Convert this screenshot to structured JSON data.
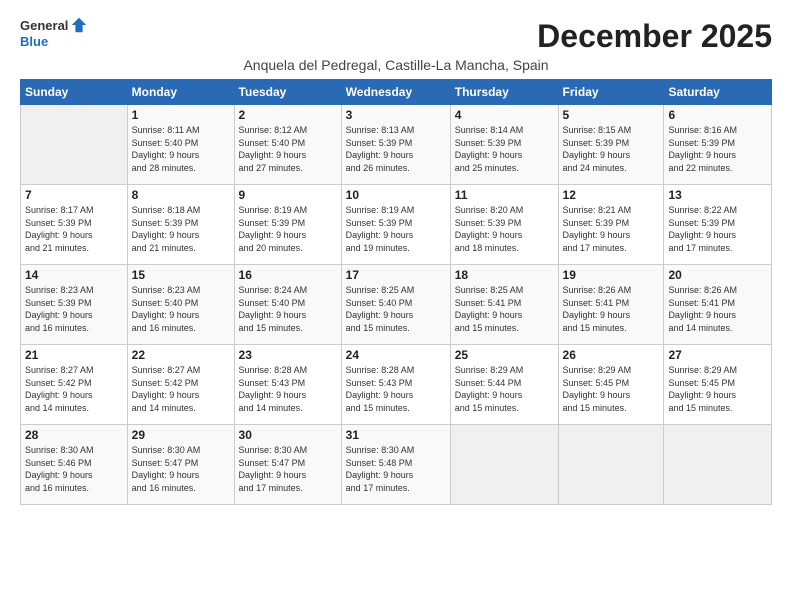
{
  "logo": {
    "line1": "General",
    "line2": "Blue"
  },
  "title": "December 2025",
  "subtitle": "Anquela del Pedregal, Castille-La Mancha, Spain",
  "days_of_week": [
    "Sunday",
    "Monday",
    "Tuesday",
    "Wednesday",
    "Thursday",
    "Friday",
    "Saturday"
  ],
  "weeks": [
    [
      {
        "day": "",
        "info": ""
      },
      {
        "day": "1",
        "info": "Sunrise: 8:11 AM\nSunset: 5:40 PM\nDaylight: 9 hours\nand 28 minutes."
      },
      {
        "day": "2",
        "info": "Sunrise: 8:12 AM\nSunset: 5:40 PM\nDaylight: 9 hours\nand 27 minutes."
      },
      {
        "day": "3",
        "info": "Sunrise: 8:13 AM\nSunset: 5:39 PM\nDaylight: 9 hours\nand 26 minutes."
      },
      {
        "day": "4",
        "info": "Sunrise: 8:14 AM\nSunset: 5:39 PM\nDaylight: 9 hours\nand 25 minutes."
      },
      {
        "day": "5",
        "info": "Sunrise: 8:15 AM\nSunset: 5:39 PM\nDaylight: 9 hours\nand 24 minutes."
      },
      {
        "day": "6",
        "info": "Sunrise: 8:16 AM\nSunset: 5:39 PM\nDaylight: 9 hours\nand 22 minutes."
      }
    ],
    [
      {
        "day": "7",
        "info": "Sunrise: 8:17 AM\nSunset: 5:39 PM\nDaylight: 9 hours\nand 21 minutes."
      },
      {
        "day": "8",
        "info": "Sunrise: 8:18 AM\nSunset: 5:39 PM\nDaylight: 9 hours\nand 21 minutes."
      },
      {
        "day": "9",
        "info": "Sunrise: 8:19 AM\nSunset: 5:39 PM\nDaylight: 9 hours\nand 20 minutes."
      },
      {
        "day": "10",
        "info": "Sunrise: 8:19 AM\nSunset: 5:39 PM\nDaylight: 9 hours\nand 19 minutes."
      },
      {
        "day": "11",
        "info": "Sunrise: 8:20 AM\nSunset: 5:39 PM\nDaylight: 9 hours\nand 18 minutes."
      },
      {
        "day": "12",
        "info": "Sunrise: 8:21 AM\nSunset: 5:39 PM\nDaylight: 9 hours\nand 17 minutes."
      },
      {
        "day": "13",
        "info": "Sunrise: 8:22 AM\nSunset: 5:39 PM\nDaylight: 9 hours\nand 17 minutes."
      }
    ],
    [
      {
        "day": "14",
        "info": "Sunrise: 8:23 AM\nSunset: 5:39 PM\nDaylight: 9 hours\nand 16 minutes."
      },
      {
        "day": "15",
        "info": "Sunrise: 8:23 AM\nSunset: 5:40 PM\nDaylight: 9 hours\nand 16 minutes."
      },
      {
        "day": "16",
        "info": "Sunrise: 8:24 AM\nSunset: 5:40 PM\nDaylight: 9 hours\nand 15 minutes."
      },
      {
        "day": "17",
        "info": "Sunrise: 8:25 AM\nSunset: 5:40 PM\nDaylight: 9 hours\nand 15 minutes."
      },
      {
        "day": "18",
        "info": "Sunrise: 8:25 AM\nSunset: 5:41 PM\nDaylight: 9 hours\nand 15 minutes."
      },
      {
        "day": "19",
        "info": "Sunrise: 8:26 AM\nSunset: 5:41 PM\nDaylight: 9 hours\nand 15 minutes."
      },
      {
        "day": "20",
        "info": "Sunrise: 8:26 AM\nSunset: 5:41 PM\nDaylight: 9 hours\nand 14 minutes."
      }
    ],
    [
      {
        "day": "21",
        "info": "Sunrise: 8:27 AM\nSunset: 5:42 PM\nDaylight: 9 hours\nand 14 minutes."
      },
      {
        "day": "22",
        "info": "Sunrise: 8:27 AM\nSunset: 5:42 PM\nDaylight: 9 hours\nand 14 minutes."
      },
      {
        "day": "23",
        "info": "Sunrise: 8:28 AM\nSunset: 5:43 PM\nDaylight: 9 hours\nand 14 minutes."
      },
      {
        "day": "24",
        "info": "Sunrise: 8:28 AM\nSunset: 5:43 PM\nDaylight: 9 hours\nand 15 minutes."
      },
      {
        "day": "25",
        "info": "Sunrise: 8:29 AM\nSunset: 5:44 PM\nDaylight: 9 hours\nand 15 minutes."
      },
      {
        "day": "26",
        "info": "Sunrise: 8:29 AM\nSunset: 5:45 PM\nDaylight: 9 hours\nand 15 minutes."
      },
      {
        "day": "27",
        "info": "Sunrise: 8:29 AM\nSunset: 5:45 PM\nDaylight: 9 hours\nand 15 minutes."
      }
    ],
    [
      {
        "day": "28",
        "info": "Sunrise: 8:30 AM\nSunset: 5:46 PM\nDaylight: 9 hours\nand 16 minutes."
      },
      {
        "day": "29",
        "info": "Sunrise: 8:30 AM\nSunset: 5:47 PM\nDaylight: 9 hours\nand 16 minutes."
      },
      {
        "day": "30",
        "info": "Sunrise: 8:30 AM\nSunset: 5:47 PM\nDaylight: 9 hours\nand 17 minutes."
      },
      {
        "day": "31",
        "info": "Sunrise: 8:30 AM\nSunset: 5:48 PM\nDaylight: 9 hours\nand 17 minutes."
      },
      {
        "day": "",
        "info": ""
      },
      {
        "day": "",
        "info": ""
      },
      {
        "day": "",
        "info": ""
      }
    ]
  ]
}
